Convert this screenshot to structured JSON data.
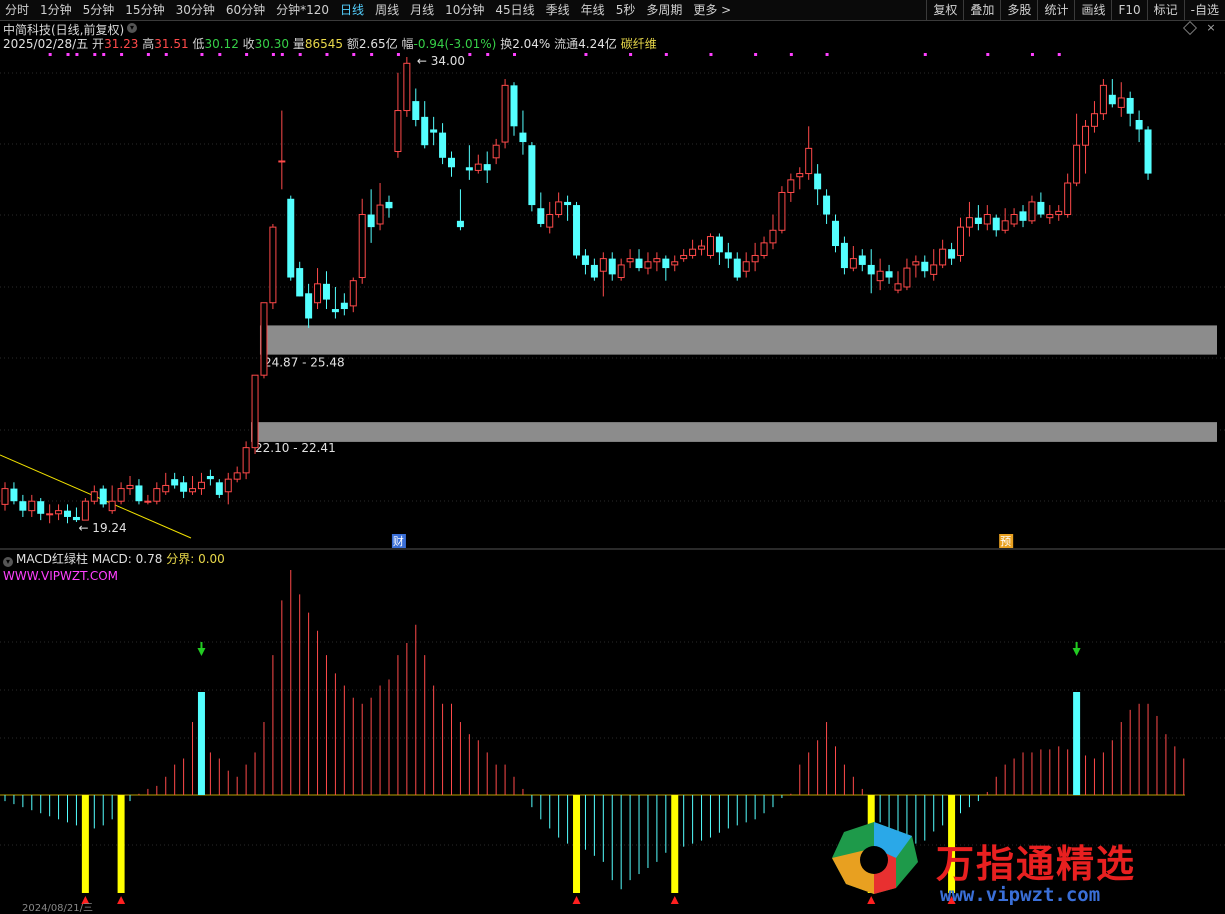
{
  "toolbar": {
    "tabs": [
      "分时",
      "1分钟",
      "5分钟",
      "15分钟",
      "30分钟",
      "60分钟",
      "分钟*120",
      "日线",
      "周线",
      "月线",
      "10分钟",
      "45日线",
      "季线",
      "年线",
      "5秒",
      "多周期",
      "更多 >"
    ],
    "active_tab": "日线",
    "tools": [
      "复权",
      "叠加",
      "多股",
      "统计",
      "画线",
      "F10",
      "标记",
      "-自选"
    ]
  },
  "header": {
    "title": "中简科技(日线,前复权)",
    "date": "2025/02/28/五",
    "open_label": "开",
    "open": "31.23",
    "high_label": "高",
    "high": "31.51",
    "low_label": "低",
    "low": "30.12",
    "close_label": "收",
    "close": "30.30",
    "volume_label": "量",
    "volume": "86545",
    "amount_label": "额",
    "amount": "2.65亿",
    "change_label": "幅",
    "change": "-0.94(-3.01%)",
    "turnover_label": "换",
    "turnover": "2.04%",
    "float_label": "流通",
    "float": "4.24亿",
    "concept": "碳纤维"
  },
  "macd_header": {
    "name": "MACD红绿柱",
    "macd_label": "MACD:",
    "macd_value": "0.78",
    "boundary_label": "分界:",
    "boundary_value": "0.00",
    "site": "WWW.VIPWZT.COM"
  },
  "watermark": {
    "text": "万指通精选",
    "url": "www.vipwzt.com"
  },
  "bottom": {
    "date": "2024/08/21/三"
  },
  "colors": {
    "up": "#ff4a4a",
    "down": "#54ffff",
    "zones": "#8c8c8c",
    "trendline": "#f0e000",
    "macd_pos": "#ff4a4a",
    "macd_neg": "#54ffff",
    "signal": "#ffff00",
    "arrow": "#22cc22",
    "magenta": "#ff40ff"
  },
  "chart_data": {
    "type": "candlestick",
    "price_range": [
      18,
      35
    ],
    "annotations": {
      "high_label": "34.00",
      "low_label": "19.24",
      "zone_upper": "24.87 - 25.48",
      "zone_lower": "22.10 - 22.41",
      "event_fin": "财",
      "event_pre": "预"
    },
    "zones": [
      {
        "label_key": "zone_upper",
        "low": 24.87,
        "high": 25.48
      },
      {
        "label_key": "zone_lower",
        "low": 22.1,
        "high": 22.41
      }
    ],
    "candles": [
      [
        19.8,
        20.3,
        20.5,
        19.6
      ],
      [
        20.3,
        19.9,
        20.5,
        19.8
      ],
      [
        19.9,
        19.6,
        20.1,
        19.4
      ],
      [
        19.6,
        19.9,
        20.1,
        19.4
      ],
      [
        19.9,
        19.5,
        20.0,
        19.3
      ],
      [
        19.5,
        19.5,
        19.8,
        19.2
      ],
      [
        19.5,
        19.6,
        19.8,
        19.3
      ],
      [
        19.6,
        19.4,
        19.8,
        19.2
      ],
      [
        19.4,
        19.3,
        19.7,
        19.24
      ],
      [
        19.3,
        19.9,
        20.0,
        19.3
      ],
      [
        19.9,
        20.2,
        20.4,
        19.8
      ],
      [
        20.3,
        19.8,
        20.4,
        19.7
      ],
      [
        19.6,
        19.9,
        20.4,
        19.5
      ],
      [
        19.9,
        20.3,
        20.5,
        19.8
      ],
      [
        20.3,
        20.4,
        20.7,
        20.1
      ],
      [
        20.4,
        19.9,
        20.6,
        19.8
      ],
      [
        19.9,
        19.9,
        20.1,
        19.8
      ],
      [
        19.9,
        20.3,
        20.5,
        19.8
      ],
      [
        20.2,
        20.4,
        20.8,
        20.1
      ],
      [
        20.6,
        20.4,
        20.8,
        20.3
      ],
      [
        20.5,
        20.2,
        20.7,
        20.0
      ],
      [
        20.2,
        20.3,
        20.7,
        20.1
      ],
      [
        20.3,
        20.5,
        20.8,
        20.1
      ],
      [
        20.7,
        20.6,
        20.9,
        20.4
      ],
      [
        20.5,
        20.1,
        20.6,
        20.0
      ],
      [
        20.2,
        20.6,
        20.8,
        19.8
      ],
      [
        20.6,
        20.8,
        21.0,
        20.5
      ],
      [
        20.8,
        21.6,
        21.8,
        20.6
      ],
      [
        21.6,
        23.9,
        23.9,
        21.4
      ],
      [
        23.9,
        26.2,
        26.2,
        23.8
      ],
      [
        26.2,
        28.6,
        28.7,
        26.0
      ],
      [
        30.7,
        30.7,
        32.3,
        29.8
      ],
      [
        29.5,
        27.0,
        29.6,
        26.9
      ],
      [
        27.3,
        26.4,
        27.5,
        26.4
      ],
      [
        26.5,
        25.7,
        26.8,
        25.4
      ],
      [
        26.2,
        26.8,
        27.3,
        26.0
      ],
      [
        26.8,
        26.3,
        27.2,
        26.0
      ],
      [
        26.0,
        25.9,
        26.7,
        25.7
      ],
      [
        26.2,
        26.0,
        26.5,
        25.8
      ],
      [
        26.1,
        26.9,
        27.0,
        25.9
      ],
      [
        27.0,
        29.0,
        29.5,
        26.8
      ],
      [
        29.0,
        28.6,
        29.8,
        28.1
      ],
      [
        28.7,
        29.3,
        30.0,
        28.5
      ],
      [
        29.4,
        29.2,
        29.6,
        28.9
      ],
      [
        31.0,
        32.3,
        33.5,
        30.8
      ],
      [
        32.3,
        33.8,
        34.0,
        32.1
      ],
      [
        32.6,
        32.0,
        33.0,
        31.8
      ],
      [
        32.1,
        31.2,
        32.6,
        31.1
      ],
      [
        31.7,
        31.6,
        32.1,
        31.2
      ],
      [
        31.6,
        30.8,
        31.9,
        30.6
      ],
      [
        30.8,
        30.5,
        31.0,
        30.2
      ],
      [
        28.8,
        28.6,
        29.8,
        28.5
      ],
      [
        30.5,
        30.4,
        31.2,
        30.1
      ],
      [
        30.4,
        30.6,
        30.9,
        30.3
      ],
      [
        30.6,
        30.4,
        31.0,
        30.0
      ],
      [
        30.8,
        31.2,
        31.4,
        30.6
      ],
      [
        31.3,
        33.1,
        33.3,
        31.1
      ],
      [
        33.1,
        31.8,
        33.2,
        31.5
      ],
      [
        31.6,
        31.3,
        32.3,
        30.9
      ],
      [
        31.2,
        29.3,
        31.3,
        29.1
      ],
      [
        29.2,
        28.7,
        29.7,
        28.6
      ],
      [
        28.6,
        29.0,
        29.4,
        28.4
      ],
      [
        29.0,
        29.4,
        29.7,
        28.9
      ],
      [
        29.4,
        29.3,
        29.6,
        28.8
      ],
      [
        29.3,
        27.7,
        29.4,
        27.6
      ],
      [
        27.7,
        27.4,
        27.9,
        27.1
      ],
      [
        27.4,
        27.0,
        27.6,
        26.9
      ],
      [
        27.2,
        27.6,
        27.8,
        26.4
      ],
      [
        27.6,
        27.1,
        27.8,
        26.9
      ],
      [
        27.0,
        27.4,
        27.6,
        26.9
      ],
      [
        27.5,
        27.6,
        27.9,
        27.3
      ],
      [
        27.6,
        27.3,
        27.9,
        27.2
      ],
      [
        27.3,
        27.5,
        27.8,
        27.1
      ],
      [
        27.5,
        27.6,
        27.8,
        27.2
      ],
      [
        27.6,
        27.3,
        27.7,
        26.9
      ],
      [
        27.4,
        27.5,
        27.7,
        27.2
      ],
      [
        27.6,
        27.7,
        27.9,
        27.5
      ],
      [
        27.7,
        27.9,
        28.2,
        27.6
      ],
      [
        27.9,
        28.0,
        28.2,
        27.7
      ],
      [
        27.7,
        28.3,
        28.4,
        27.6
      ],
      [
        28.3,
        27.8,
        28.4,
        27.4
      ],
      [
        27.8,
        27.6,
        28.1,
        27.3
      ],
      [
        27.6,
        27.0,
        27.8,
        26.9
      ],
      [
        27.2,
        27.5,
        27.8,
        27.0
      ],
      [
        27.5,
        27.7,
        28.1,
        27.2
      ],
      [
        27.7,
        28.1,
        28.3,
        27.6
      ],
      [
        28.1,
        28.5,
        29.0,
        27.9
      ],
      [
        28.5,
        29.7,
        29.9,
        28.4
      ],
      [
        29.7,
        30.1,
        30.3,
        29.4
      ],
      [
        30.2,
        30.3,
        30.5,
        29.8
      ],
      [
        30.3,
        31.1,
        31.8,
        30.1
      ],
      [
        30.3,
        29.8,
        30.6,
        29.3
      ],
      [
        29.6,
        29.0,
        29.8,
        28.7
      ],
      [
        28.8,
        28.0,
        29.0,
        27.8
      ],
      [
        28.1,
        27.3,
        28.3,
        27.1
      ],
      [
        27.3,
        27.6,
        28.0,
        27.2
      ],
      [
        27.7,
        27.4,
        27.9,
        27.2
      ],
      [
        27.4,
        27.1,
        27.9,
        26.5
      ],
      [
        26.9,
        27.2,
        27.6,
        26.6
      ],
      [
        27.2,
        27.0,
        27.4,
        26.8
      ],
      [
        26.6,
        26.8,
        27.2,
        26.5
      ],
      [
        26.7,
        27.3,
        27.6,
        26.6
      ],
      [
        27.4,
        27.5,
        27.7,
        27.0
      ],
      [
        27.5,
        27.2,
        27.7,
        27.0
      ],
      [
        27.1,
        27.4,
        27.9,
        26.9
      ],
      [
        27.4,
        27.9,
        28.2,
        27.3
      ],
      [
        27.9,
        27.6,
        28.1,
        27.4
      ],
      [
        27.7,
        28.6,
        28.9,
        27.5
      ],
      [
        28.6,
        28.9,
        29.4,
        28.3
      ],
      [
        28.9,
        28.7,
        29.3,
        28.5
      ],
      [
        28.7,
        29.0,
        29.3,
        28.5
      ],
      [
        28.9,
        28.5,
        29.0,
        28.3
      ],
      [
        28.5,
        28.8,
        29.2,
        28.4
      ],
      [
        28.7,
        29.0,
        29.2,
        28.6
      ],
      [
        29.1,
        28.8,
        29.3,
        28.6
      ],
      [
        28.8,
        29.4,
        29.6,
        28.7
      ],
      [
        29.4,
        29.0,
        29.7,
        28.9
      ],
      [
        28.9,
        29.0,
        29.3,
        28.7
      ],
      [
        29.0,
        29.1,
        29.3,
        28.8
      ],
      [
        29.0,
        30.0,
        30.3,
        28.9
      ],
      [
        30.0,
        31.2,
        32.2,
        29.9
      ],
      [
        31.2,
        31.8,
        32.0,
        30.3
      ],
      [
        31.8,
        32.2,
        32.6,
        31.6
      ],
      [
        32.2,
        33.1,
        33.3,
        32.0
      ],
      [
        32.8,
        32.5,
        33.3,
        32.4
      ],
      [
        32.4,
        32.7,
        33.2,
        32.1
      ],
      [
        32.7,
        32.2,
        32.9,
        31.8
      ],
      [
        32.0,
        31.7,
        32.3,
        31.3
      ],
      [
        31.7,
        30.3,
        31.8,
        30.1
      ]
    ],
    "macd_range": [
      -1.8,
      4.2
    ],
    "macd": [
      -0.1,
      -0.15,
      -0.2,
      -0.25,
      -0.3,
      -0.35,
      -0.4,
      -0.45,
      -0.5,
      -0.6,
      -0.55,
      -0.5,
      -0.4,
      -0.25,
      -0.1,
      0.02,
      0.1,
      0.15,
      0.3,
      0.5,
      0.6,
      1.2,
      0.9,
      0.7,
      0.6,
      0.4,
      0.3,
      0.5,
      0.7,
      1.2,
      2.3,
      3.2,
      3.7,
      3.3,
      3.0,
      2.7,
      2.3,
      2.0,
      1.8,
      1.6,
      1.5,
      1.6,
      1.8,
      1.9,
      2.3,
      2.5,
      2.8,
      2.3,
      1.8,
      1.5,
      1.5,
      1.2,
      1.0,
      0.9,
      0.7,
      0.5,
      0.5,
      0.3,
      0.1,
      -0.2,
      -0.4,
      -0.55,
      -0.7,
      -0.8,
      -0.85,
      -0.9,
      -1.0,
      -1.1,
      -1.4,
      -1.55,
      -1.4,
      -1.3,
      -1.2,
      -1.1,
      -0.95,
      -0.9,
      -0.85,
      -0.8,
      -0.75,
      -0.7,
      -0.62,
      -0.55,
      -0.5,
      -0.45,
      -0.4,
      -0.3,
      -0.2,
      -0.05,
      0.02,
      0.5,
      0.7,
      0.9,
      1.2,
      0.8,
      0.5,
      0.3,
      0.1,
      -0.2,
      -0.45,
      -0.6,
      -0.7,
      -0.75,
      -0.8,
      -0.75,
      -0.6,
      -0.5,
      -0.4,
      -0.3,
      -0.2,
      -0.1,
      0.05,
      0.3,
      0.5,
      0.6,
      0.7,
      0.7,
      0.75,
      0.75,
      0.8,
      0.75,
      0.7,
      0.65,
      0.6,
      0.7,
      0.9,
      1.2,
      1.4,
      1.5,
      1.5,
      1.3,
      1.0,
      0.8,
      0.6
    ],
    "signal_bars": [
      9,
      13,
      22,
      64,
      75,
      97,
      106,
      120
    ],
    "top_markers": [
      5,
      7,
      8,
      10,
      11,
      13,
      16,
      18,
      22,
      24,
      27,
      30,
      31,
      33,
      36,
      39,
      41,
      44,
      52,
      54,
      57,
      65,
      70,
      74,
      79,
      84,
      88,
      92,
      103,
      110,
      115,
      118
    ]
  }
}
